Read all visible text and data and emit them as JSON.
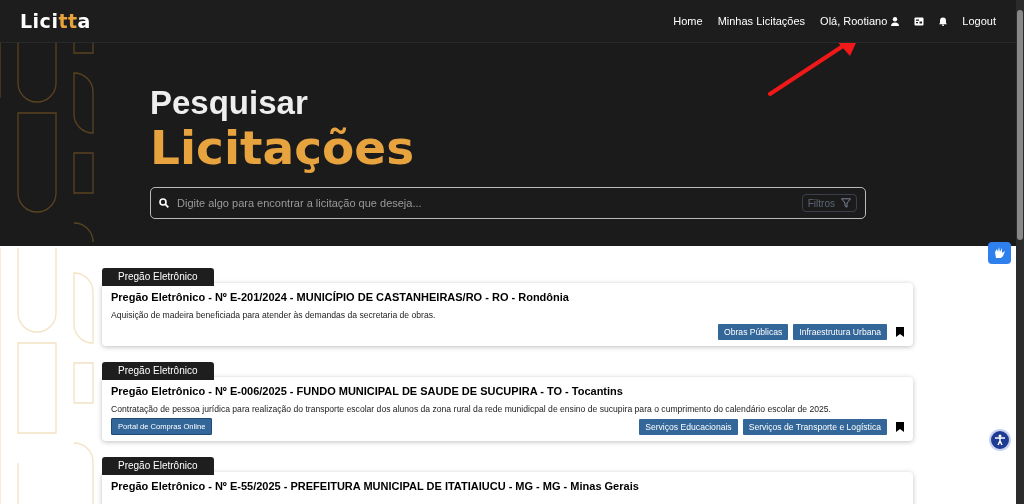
{
  "navbar": {
    "logo": {
      "start": "Lici",
      "accent": "tt",
      "end": "a"
    },
    "items": [
      {
        "kind": "link",
        "label": "Home"
      },
      {
        "kind": "link",
        "label": "Minhas Licitações"
      },
      {
        "kind": "user",
        "label": "Olá, Rootiano"
      },
      {
        "kind": "card-icon"
      },
      {
        "kind": "bell-icon"
      },
      {
        "kind": "link",
        "label": "Logout"
      }
    ]
  },
  "hero": {
    "title_line_1": "Pesquisar",
    "title_line_2": "Licitações",
    "search": {
      "placeholder": "Digite algo para encontrar a licitação que deseja...",
      "filter_button": "Filtros"
    }
  },
  "results": [
    {
      "tag": "Pregão Eletrônico",
      "title": "Pregão Eletrônico - Nº E-201/2024 - MUNICÍPIO DE CASTANHEIRAS/RO - RO - Rondônia",
      "description": "Aquisição de madeira beneficiada para atender às demandas da secretaria de obras.",
      "categories": [
        "Obras Públicas",
        "Infraestrutura Urbana"
      ]
    },
    {
      "tag": "Pregão Eletrônico",
      "title": "Pregão Eletrônico - Nº E-006/2025 - FUNDO MUNICIPAL DE SAUDE DE SUCUPIRA - TO - Tocantins",
      "description": "Contratação de pessoa jurídica para realização do transporte escolar dos alunos da zona rural da rede munidicpal de ensino de sucupira para o cumprimento do calendário escolar de 2025.",
      "portal": "Portal de Compras Online",
      "categories": [
        "Serviços Educacionais",
        "Serviços de Transporte e Logística"
      ]
    },
    {
      "tag": "Pregão Eletrônico",
      "title": "Pregão Eletrônico - Nº E-55/2025 - PREFEITURA MUNICIPAL DE ITATIAIUCU - MG - MG - Minas Gerais"
    }
  ]
}
